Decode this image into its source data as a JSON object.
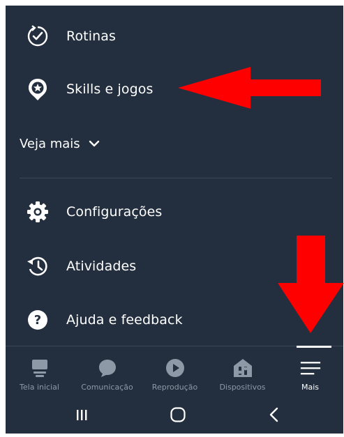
{
  "menu": {
    "items": [
      {
        "label": "Rotinas",
        "icon": "routines-icon"
      },
      {
        "label": "Skills e jogos",
        "icon": "skills-icon"
      }
    ],
    "see_more": {
      "label": "Veja mais",
      "icon": "chevron-down-icon"
    },
    "settings_items": [
      {
        "label": "Configurações",
        "icon": "gear-icon"
      },
      {
        "label": "Atividades",
        "icon": "history-icon"
      },
      {
        "label": "Ajuda e feedback",
        "icon": "help-icon"
      }
    ]
  },
  "tabbar": {
    "tabs": [
      {
        "label": "Tela inicial",
        "icon": "home-icon",
        "active": false
      },
      {
        "label": "Comunicação",
        "icon": "chat-bubble-icon",
        "active": false
      },
      {
        "label": "Reprodução",
        "icon": "play-icon",
        "active": false
      },
      {
        "label": "Dispositivos",
        "icon": "devices-icon",
        "active": false
      },
      {
        "label": "Mais",
        "icon": "menu-icon",
        "active": true
      }
    ]
  },
  "system_nav": {
    "buttons": [
      "recents-icon",
      "home-circle-icon",
      "back-icon"
    ]
  },
  "colors": {
    "background": "#232f3e",
    "text": "#ffffff",
    "muted": "#8e99a8",
    "annotation_arrow": "#ff0000"
  }
}
